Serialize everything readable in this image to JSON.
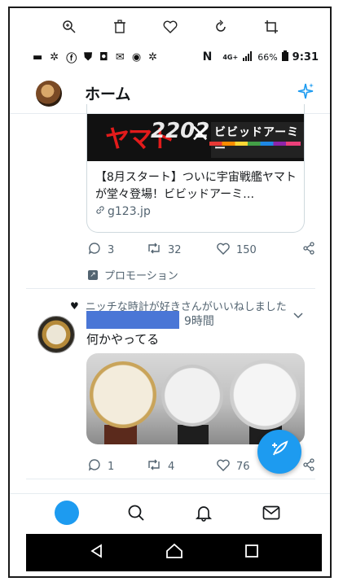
{
  "viewer_toolbar": {
    "icons": [
      "zoom-in-icon",
      "trash-icon",
      "heart-outline-icon",
      "rotate-icon",
      "crop-icon"
    ]
  },
  "status_bar": {
    "notification_icons": [
      "message-icon",
      "sparkle-notification-icon",
      "facebook-icon",
      "android-icon",
      "instagram-icon",
      "mail-icon",
      "chrome-icon",
      "sparkle-notification-icon"
    ],
    "nfc": "N",
    "network": "4G+",
    "battery": "66%",
    "time": "9:31"
  },
  "header": {
    "title": "ホーム"
  },
  "ad_card": {
    "banner_yamato": "ヤマト",
    "banner_2202": "2202",
    "banner_x": "×",
    "banner_vivid": "ビビッドアーミー",
    "text": "【8月スタート】ついに宇宙戦艦ヤマトが堂々登場！ビビッドアーミ…",
    "link": "g123.jp"
  },
  "ad_actions": {
    "replies": "3",
    "retweets": "32",
    "likes": "150"
  },
  "promo_label": "プロモーション",
  "tweet": {
    "liked_by": "ニッチな時計が好きさんがいいねしました",
    "time": "9時間",
    "text": "何かやってる",
    "replies": "1",
    "retweets": "4",
    "likes": "76"
  },
  "colors": {
    "accent": "#1d9bf0",
    "text": "#14171a",
    "muted": "#536471",
    "redaction": "#4a76d6"
  }
}
